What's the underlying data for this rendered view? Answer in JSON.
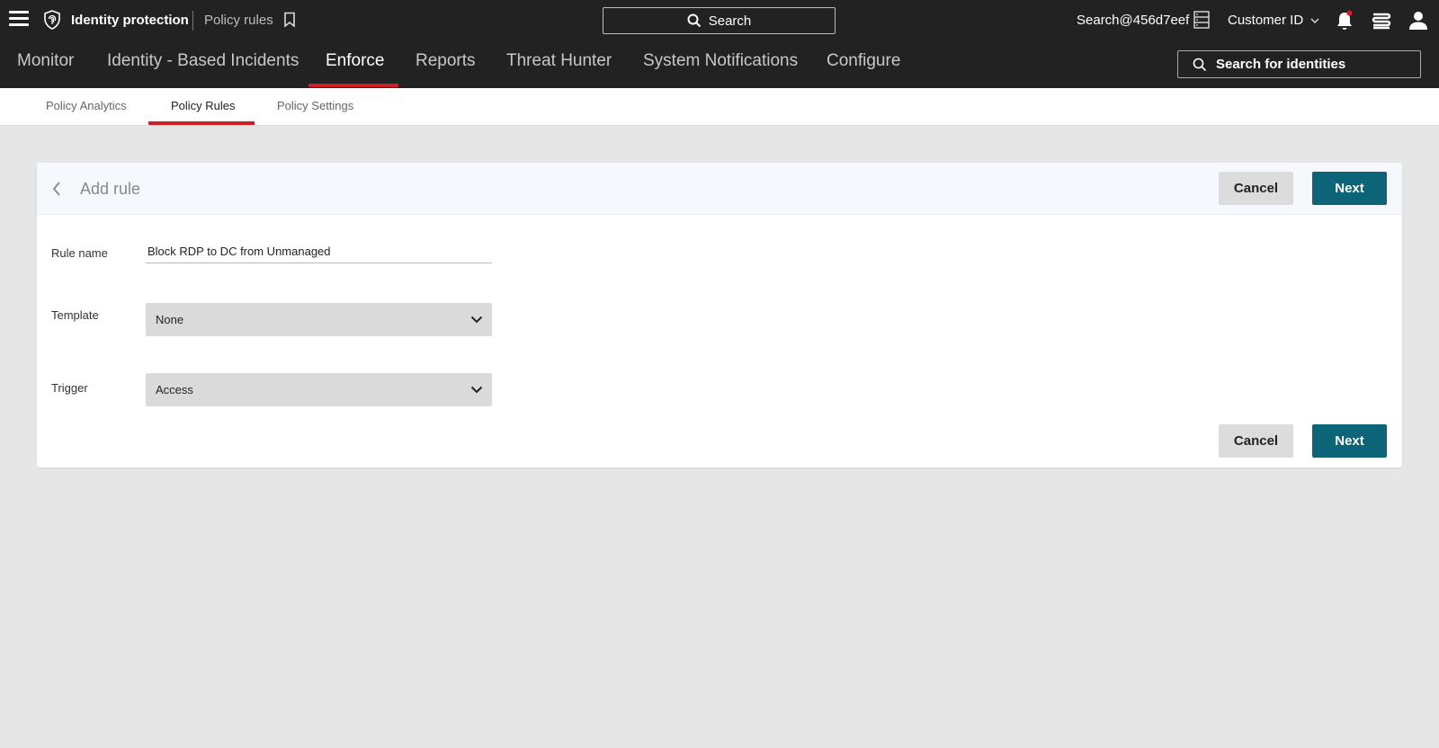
{
  "topbar": {
    "app_title": "Identity protection",
    "breadcrumb": "Policy rules",
    "search_label": "Search",
    "user_email": "Search@456d7eef",
    "customer_label": "Customer ID"
  },
  "mainnav": {
    "items": [
      {
        "label": "Monitor"
      },
      {
        "label": "Identity - Based Incidents"
      },
      {
        "label": "Enforce",
        "active": true
      },
      {
        "label": "Reports"
      },
      {
        "label": "Threat Hunter"
      },
      {
        "label": "System Notifications"
      },
      {
        "label": "Configure"
      }
    ],
    "identity_search_label": "Search for identities"
  },
  "subnav": {
    "items": [
      {
        "label": "Policy Analytics"
      },
      {
        "label": "Policy Rules",
        "active": true
      },
      {
        "label": "Policy Settings"
      }
    ]
  },
  "form": {
    "title": "Add rule",
    "cancel_label": "Cancel",
    "next_label": "Next",
    "rule_name_label": "Rule name",
    "rule_name_value": "Block RDP to DC from Unmanaged",
    "template_label": "Template",
    "template_value": "None",
    "trigger_label": "Trigger",
    "trigger_value": "Access"
  },
  "colors": {
    "header_bg": "#222222",
    "accent_red": "#d11f26",
    "primary_button": "#0b6478",
    "page_bg": "#e6e6e6"
  }
}
